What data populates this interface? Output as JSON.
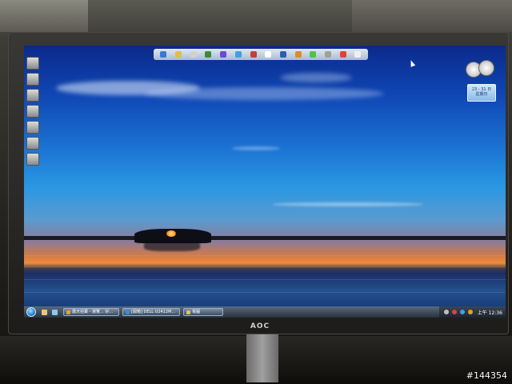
{
  "monitor": {
    "brand": "AOC"
  },
  "taskbar": {
    "tasks": [
      {
        "label": "露天拍賣 - 瀏覽... 好..."
      },
      {
        "label": "[開箱] DELL U2412M..."
      },
      {
        "label": "電腦"
      }
    ],
    "clock": "上午 12:36"
  },
  "gadgets": {
    "calendar_text": "23 - 31 日\n星期日"
  },
  "watermark": "#144354",
  "colors": {
    "sky_top": "#0b2a8a",
    "sky_mid": "#2a98e2",
    "sunset": "#ee8a3a",
    "water": "#24508e"
  },
  "icons": [
    "start-orb-icon",
    "sun-icon",
    "clock-gadget-icon",
    "calendar-gadget-icon",
    "cursor-icon"
  ]
}
